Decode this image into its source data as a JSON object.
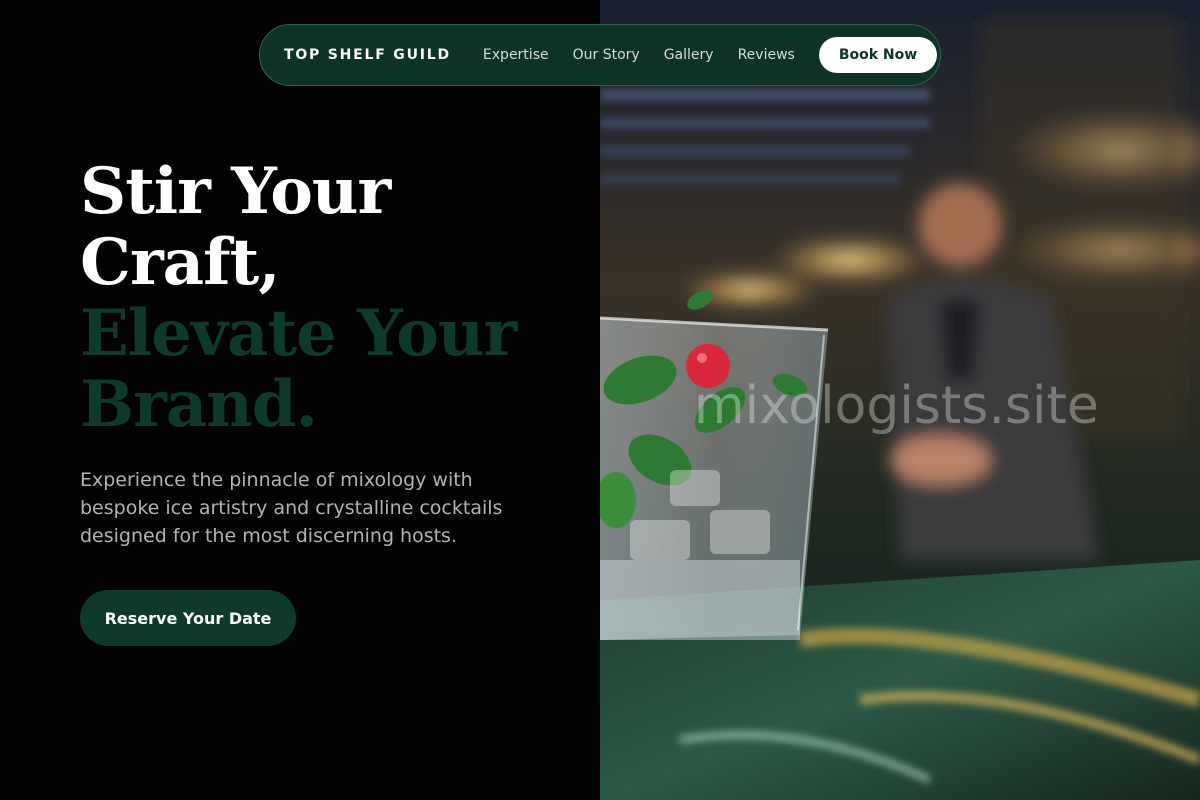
{
  "nav": {
    "brand": "TOP SHELF GUILD",
    "links": [
      "Expertise",
      "Our Story",
      "Gallery",
      "Reviews"
    ],
    "cta_label": "Book Now"
  },
  "hero": {
    "title_lines": [
      "Stir Your",
      "Craft,"
    ],
    "title_accent_lines": [
      "Elevate Your",
      "Brand."
    ],
    "subtitle": "Experience the pinnacle of mixology with bespoke ice artistry and crystalline cocktails designed for the most discerning hosts.",
    "cta_label": "Reserve Your Date"
  },
  "image": {
    "watermark": "mixologists.site"
  },
  "colors": {
    "brand_green": "#0d3327",
    "accent_green": "#0d3a2b",
    "background": "#020202",
    "text_muted": "#b3b3b3",
    "white": "#ffffff"
  }
}
